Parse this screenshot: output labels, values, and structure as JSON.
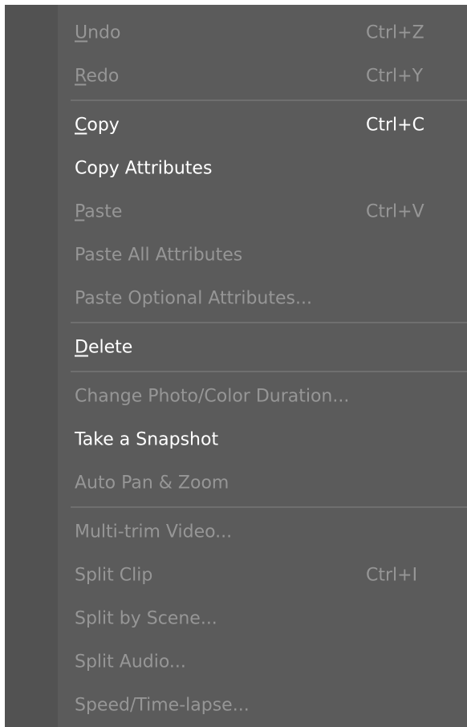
{
  "menu": {
    "items": [
      {
        "mnemonic": "U",
        "label": "ndo",
        "shortcut": "Ctrl+Z",
        "enabled": false
      },
      {
        "mnemonic": "R",
        "label": "edo",
        "shortcut": "Ctrl+Y",
        "enabled": false
      },
      {
        "mnemonic": "C",
        "label": "opy",
        "shortcut": "Ctrl+C",
        "enabled": true
      },
      {
        "mnemonic": "",
        "label": "Copy Attributes",
        "shortcut": "",
        "enabled": true
      },
      {
        "mnemonic": "P",
        "label": "aste",
        "shortcut": "Ctrl+V",
        "enabled": false
      },
      {
        "mnemonic": "",
        "label": "Paste All Attributes",
        "shortcut": "",
        "enabled": false
      },
      {
        "mnemonic": "",
        "label": "Paste Optional Attributes...",
        "shortcut": "",
        "enabled": false
      },
      {
        "mnemonic": "D",
        "label": "elete",
        "shortcut": "",
        "enabled": true
      },
      {
        "mnemonic": "",
        "label": "Change Photo/Color Duration...",
        "shortcut": "",
        "enabled": false
      },
      {
        "mnemonic": "",
        "label": "Take a Snapshot",
        "shortcut": "",
        "enabled": true
      },
      {
        "mnemonic": "",
        "label": "Auto Pan & Zoom",
        "shortcut": "",
        "enabled": false
      },
      {
        "mnemonic": "",
        "label": "Multi-trim Video...",
        "shortcut": "",
        "enabled": false
      },
      {
        "mnemonic": "",
        "label": "Split Clip",
        "shortcut": "Ctrl+I",
        "enabled": false
      },
      {
        "mnemonic": "",
        "label": "Split by Scene...",
        "shortcut": "",
        "enabled": false
      },
      {
        "mnemonic": "",
        "label": "Split Audio...",
        "shortcut": "",
        "enabled": false
      },
      {
        "mnemonic": "",
        "label": "Speed/Time-lapse...",
        "shortcut": "",
        "enabled": false
      }
    ]
  },
  "colors": {
    "background": "#5b5b5b",
    "gutter": "#525252",
    "text_enabled": "#ffffff",
    "text_disabled": "#969696",
    "separator": "#6f6f6f"
  }
}
